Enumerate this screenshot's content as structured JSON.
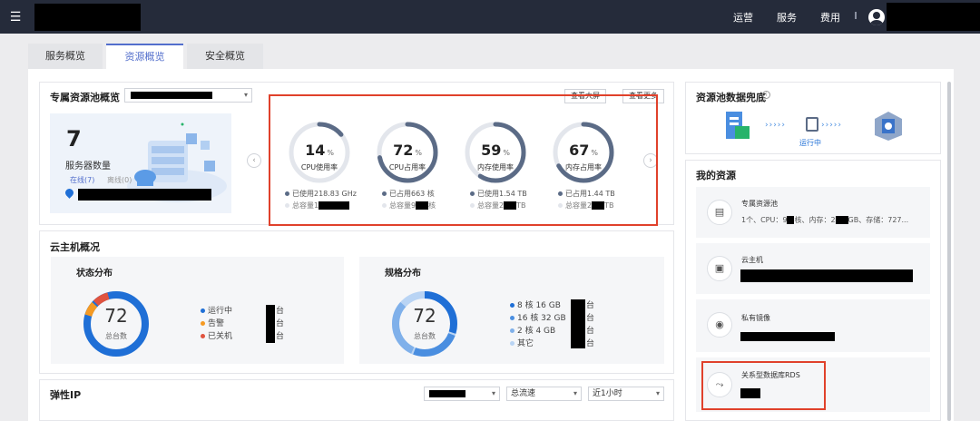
{
  "header": {
    "nav": [
      "运营",
      "服务",
      "费用"
    ]
  },
  "tabs": [
    {
      "label": "服务概览",
      "active": false
    },
    {
      "label": "资源概览",
      "active": true
    },
    {
      "label": "安全概览",
      "active": false
    }
  ],
  "pool": {
    "title": "专属资源池概览",
    "server_count": "7",
    "server_label": "服务器数量",
    "online_label": "在线(7)",
    "offline_label": "离线(0)",
    "btn_big_screen": "查看大屏",
    "btn_more": "查看更多",
    "metrics": [
      {
        "value": "14",
        "unit": "%",
        "label": "CPU使用率",
        "pct": 0.14,
        "line1": "已使用218.83 GHz",
        "line2": "总容量1"
      },
      {
        "value": "72",
        "unit": "%",
        "label": "CPU占用率",
        "pct": 0.72,
        "line1": "已占用663 核",
        "line2": "总容量9",
        "line2_suffix": "核"
      },
      {
        "value": "59",
        "unit": "%",
        "label": "内存使用率",
        "pct": 0.59,
        "line1": "已使用1.54 TB",
        "line2": "总容量2",
        "line2_suffix": "TB"
      },
      {
        "value": "67",
        "unit": "%",
        "label": "内存占用率",
        "pct": 0.67,
        "line1": "已占用1.44 TB",
        "line2": "总容量2",
        "line2_suffix": "TB"
      }
    ]
  },
  "vm": {
    "title": "云主机概况",
    "status": {
      "title": "状态分布",
      "total": "72",
      "total_label": "总台数",
      "legend": [
        {
          "label": "运行中",
          "unit": "台",
          "color": "#1f6fd6"
        },
        {
          "label": "告警",
          "unit": "台",
          "color": "#f59a23"
        },
        {
          "label": "已关机",
          "unit": "台",
          "color": "#e0533f"
        }
      ]
    },
    "spec": {
      "title": "规格分布",
      "total": "72",
      "total_label": "总台数",
      "legend": [
        {
          "label": "8 核 16 GB",
          "unit": "台",
          "color": "#1f6fd6"
        },
        {
          "label": "16 核 32 GB",
          "unit": "台",
          "color": "#4a8ee0"
        },
        {
          "label": "2 核 4 GB",
          "unit": "台",
          "color": "#7fb0ea"
        },
        {
          "label": "其它",
          "unit": "台",
          "color": "#b9d4f4"
        }
      ]
    }
  },
  "eip": {
    "title": "弹性IP",
    "select_flow": "总流速",
    "select_time": "近1小时"
  },
  "pool_bottom": {
    "title": "资源池数据兜底",
    "status": "运行中"
  },
  "my_resources": {
    "title": "我的资源",
    "items": [
      {
        "name": "专属资源池",
        "detail": "1个、CPU：9",
        "detail2": "核、内存：2",
        "detail3": "GB、存储：727...",
        "icon": "▤"
      },
      {
        "name": "云主机",
        "icon": "▣"
      },
      {
        "name": "私有镜像",
        "icon": "◉"
      },
      {
        "name": "关系型数据库RDS",
        "icon": "⤳"
      }
    ]
  },
  "colors": {
    "topbar": "#252b3a",
    "accent": "#526ecc",
    "donut": "#5b6b86",
    "track": "#e3e6ec",
    "highlight": "#e0412b"
  }
}
